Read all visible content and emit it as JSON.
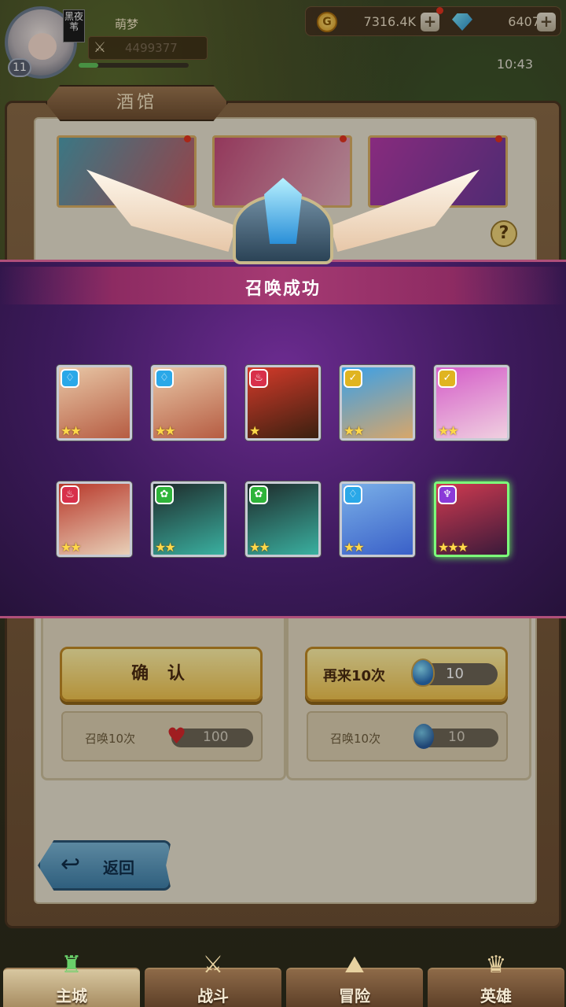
{
  "player": {
    "name": "萌梦",
    "power": "4499377",
    "level": "11",
    "vip_tag": "黑夜苇"
  },
  "resources": {
    "gold": "7316.4K",
    "gems": "6407"
  },
  "status": {
    "time": "10:43"
  },
  "tavern": {
    "title": "酒馆",
    "help_label": "?"
  },
  "modal": {
    "title": "召唤成功",
    "heroes": [
      {
        "faction": "water",
        "faction_glyph": "♢",
        "faction_color": "#2aa8e8",
        "stars": "★★",
        "art_colors": [
          "#e8c7a6",
          "#b65c42"
        ]
      },
      {
        "faction": "water",
        "faction_glyph": "♢",
        "faction_color": "#2aa8e8",
        "stars": "★★",
        "art_colors": [
          "#e8c7a6",
          "#b65c42"
        ]
      },
      {
        "faction": "fire",
        "faction_glyph": "♨",
        "faction_color": "#d8304a",
        "stars": "★",
        "art_colors": [
          "#d43a2a",
          "#3a2010"
        ]
      },
      {
        "faction": "light",
        "faction_glyph": "✓",
        "faction_color": "#e0b420",
        "stars": "★★",
        "art_colors": [
          "#3aa0e8",
          "#d7a66a"
        ]
      },
      {
        "faction": "light",
        "faction_glyph": "✓",
        "faction_color": "#e0b420",
        "stars": "★★",
        "art_colors": [
          "#d45cc8",
          "#f0d0e0"
        ]
      },
      {
        "faction": "fire",
        "faction_glyph": "♨",
        "faction_color": "#d8304a",
        "stars": "★★",
        "art_colors": [
          "#b8382a",
          "#e8d0b8"
        ]
      },
      {
        "faction": "nature",
        "faction_glyph": "✿",
        "faction_color": "#2eb43a",
        "stars": "★★",
        "art_colors": [
          "#1e2a2a",
          "#3ab0a0"
        ]
      },
      {
        "faction": "nature",
        "faction_glyph": "✿",
        "faction_color": "#2eb43a",
        "stars": "★★",
        "art_colors": [
          "#1e2a2a",
          "#3ab0a0"
        ]
      },
      {
        "faction": "water",
        "faction_glyph": "♢",
        "faction_color": "#2aa8e8",
        "stars": "★★",
        "art_colors": [
          "#7ab0e8",
          "#3a60c8"
        ]
      },
      {
        "faction": "dark",
        "faction_glyph": "♆",
        "faction_color": "#8a3ad8",
        "stars": "★★★",
        "art_colors": [
          "#d03a50",
          "#3a1a3a"
        ],
        "glow": true
      }
    ]
  },
  "actions": {
    "confirm_label": "确 认",
    "again_label": "再来10次",
    "again_cost": "10",
    "summon_label_left": "召唤10次",
    "summon_cost_left": "100",
    "summon_label_right": "召唤10次",
    "summon_cost_right": "10",
    "back_label": "返回"
  },
  "nav": [
    {
      "label": "主城",
      "icon": "castle-icon",
      "glyph": "♜",
      "active": true
    },
    {
      "label": "战斗",
      "icon": "crossed-swords-icon",
      "glyph": "⚔",
      "active": false
    },
    {
      "label": "冒险",
      "icon": "map-icon",
      "glyph": "⛰",
      "active": false
    },
    {
      "label": "英雄",
      "icon": "hero-icon",
      "glyph": "♛",
      "active": false
    }
  ]
}
